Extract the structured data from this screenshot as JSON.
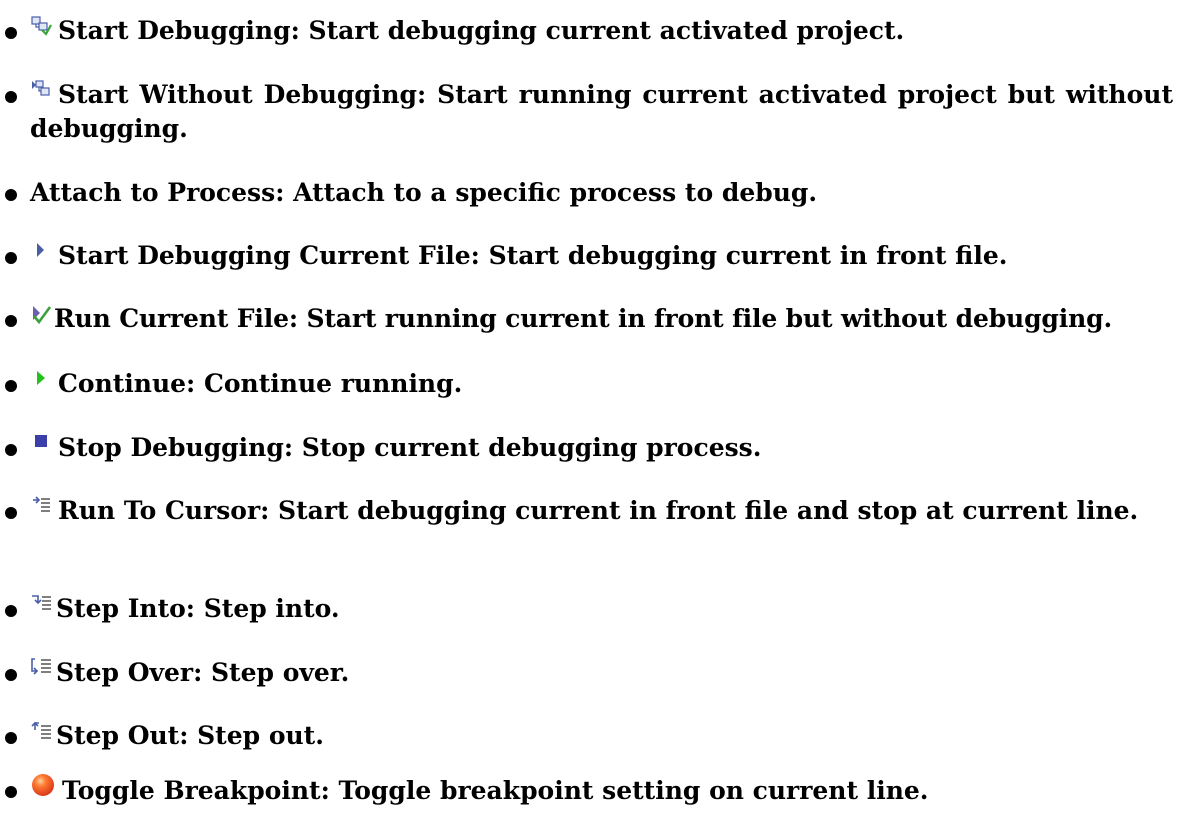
{
  "items": [
    {
      "icon": "start-debugging-icon",
      "text": "Start Debugging: Start debugging current activated project."
    },
    {
      "icon": "start-without-debugging-icon",
      "text": "Start Without Debugging: Start running current activated project but without debugging."
    },
    {
      "icon": "",
      "text": "Attach to Process: Attach to a specific process to debug."
    },
    {
      "icon": "start-debugging-current-file-icon",
      "text": "Start Debugging Current File: Start debugging current in front file."
    },
    {
      "icon": "run-current-file-icon",
      "text": "Run Current File: Start running current in front file but without debugging."
    },
    {
      "icon": "continue-icon",
      "text": "Continue: Continue running."
    },
    {
      "icon": "stop-debugging-icon",
      "text": "Stop Debugging: Stop current debugging process."
    },
    {
      "icon": "run-to-cursor-icon",
      "text": "Run To Cursor: Start debugging current in front file and stop at current line."
    },
    {
      "icon": "step-into-icon",
      "text": "Step Into: Step into."
    },
    {
      "icon": "step-over-icon",
      "text": "Step Over: Step over."
    },
    {
      "icon": "step-out-icon",
      "text": "Step Out: Step out."
    },
    {
      "icon": "toggle-breakpoint-icon",
      "text": "Toggle Breakpoint: Toggle breakpoint setting on current line."
    }
  ],
  "colors": {
    "text": "#000000",
    "continue_green": "#22c21a",
    "stop_blue": "#3b3fa8",
    "breakpoint_red": "#f0602a",
    "icon_blue": "#4a5ea8",
    "check_green": "#3da23a"
  }
}
